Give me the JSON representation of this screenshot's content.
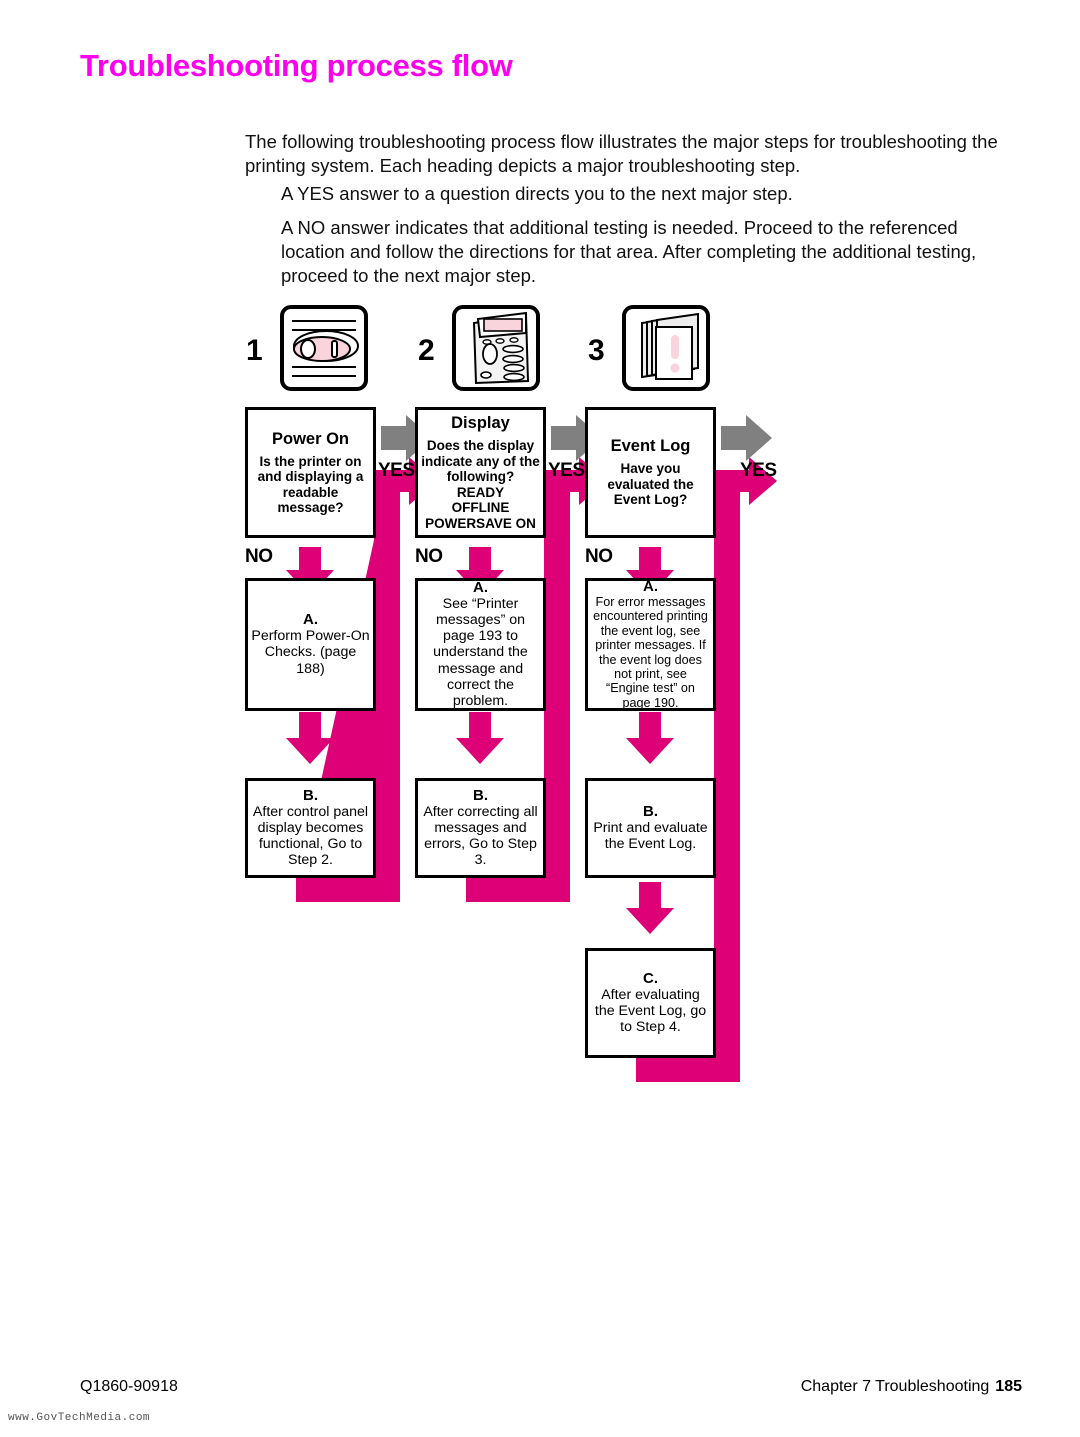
{
  "page": {
    "title": "Troubleshooting process flow",
    "title_color": "#FF00EE",
    "accent_color": "#DD0077",
    "gray_arrow_color": "#808080"
  },
  "intro": {
    "paragraph_1": "The following troubleshooting process flow illustrates the major steps for troubleshooting the printing system. Each heading depicts a major troubleshooting step.",
    "paragraph_2": "A YES answer to a question directs you to the next major step.",
    "paragraph_3": "A NO answer indicates that additional testing is needed. Proceed to the referenced location and follow the directions for that area. After completing the additional testing, proceed to the next major step."
  },
  "flow": {
    "yes_label": "YES",
    "no_label": "NO",
    "columns": [
      {
        "step_number": "1",
        "icon": "power-switch-icon",
        "header": "Power On",
        "question": "Is the printer on and displaying a readable message?",
        "boxes": [
          {
            "letter": "A.",
            "body": "Perform Power-On Checks. (page 188)"
          },
          {
            "letter": "B.",
            "body": "After control panel display becomes functional, Go to Step 2."
          }
        ]
      },
      {
        "step_number": "2",
        "icon": "control-panel-icon",
        "header": "Display",
        "question": "Does the display indicate any of the following?",
        "question_states": [
          "READY",
          "OFFLINE",
          "POWERSAVE ON"
        ],
        "boxes": [
          {
            "letter": "A.",
            "body": "See “Printer messages” on page 193 to understand the message and correct the problem."
          },
          {
            "letter": "B.",
            "body": "After correcting all messages and errors, Go to Step 3."
          }
        ]
      },
      {
        "step_number": "3",
        "icon": "event-log-pages-icon",
        "header": "Event Log",
        "question": "Have you evaluated the Event Log?",
        "boxes": [
          {
            "letter": "A.",
            "body": "For error messages encountered printing the event log, see printer messages. If the event log does not print, see “Engine test” on page 190."
          },
          {
            "letter": "B.",
            "body": "Print and evaluate the Event Log."
          },
          {
            "letter": "C.",
            "body": "After evaluating the Event Log, go to Step 4."
          }
        ]
      }
    ]
  },
  "footer": {
    "part_number": "Q1860-90918",
    "chapter": "Chapter 7 Troubleshooting",
    "page_number": "185",
    "watermark": "www.GovTechMedia.com"
  }
}
